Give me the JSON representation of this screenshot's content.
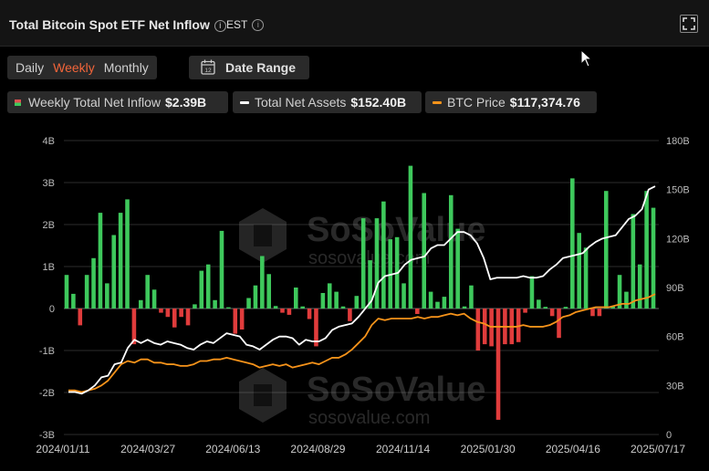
{
  "header": {
    "title": "Total Bitcoin Spot ETF Net Inflow",
    "timezone": "EST"
  },
  "tabs": [
    {
      "label": "Daily",
      "active": false
    },
    {
      "label": "Weekly",
      "active": true
    },
    {
      "label": "Monthly",
      "active": false
    }
  ],
  "date_range_label": "Date Range",
  "date_range_icon_text": "12",
  "legend": [
    {
      "label": "Weekly Total Net Inflow",
      "value": "$2.39B",
      "color": "#e05050",
      "color2": "#3ec85c"
    },
    {
      "label": "Total Net Assets",
      "value": "$152.40B",
      "color": "#ffffff"
    },
    {
      "label": "BTC Price",
      "value": "$117,374.76",
      "color": "#f7931a"
    }
  ],
  "watermark": {
    "brand": "SoSoValue",
    "url": "sosovalue.com"
  },
  "chart_data": {
    "type": "bar",
    "x_tick_labels": [
      "2024/01/11",
      "2024/03/27",
      "2024/06/13",
      "2024/08/29",
      "2024/11/14",
      "2025/01/30",
      "2025/04/16",
      "2025/07/17"
    ],
    "left_axis": {
      "ticks": [
        "4B",
        "3B",
        "2B",
        "1B",
        "0",
        "-1B",
        "-2B",
        "-3B"
      ],
      "min": -3,
      "max": 4
    },
    "right_axis": {
      "ticks": [
        "180B",
        "150B",
        "120B",
        "90B",
        "60B",
        "30B",
        "0"
      ],
      "min": 0,
      "max": 180
    },
    "colors": {
      "positive": "#3ec85c",
      "negative": "#e03c3c",
      "assets": "#ffffff",
      "price": "#f7931a"
    },
    "series": [
      {
        "name": "Weekly Total Net Inflow",
        "values": [
          0.8,
          0.35,
          -0.4,
          0.8,
          1.2,
          2.28,
          0.6,
          1.75,
          2.28,
          2.6,
          -0.85,
          0.2,
          0.8,
          0.45,
          -0.1,
          -0.2,
          -0.45,
          -0.2,
          -0.4,
          0.1,
          0.9,
          1.05,
          0.2,
          1.85,
          0.03,
          -0.6,
          -0.5,
          0.25,
          0.55,
          1.25,
          0.82,
          0.06,
          -0.1,
          -0.15,
          0.5,
          0.05,
          -0.25,
          -0.9,
          0.37,
          0.6,
          0.4,
          0.05,
          -0.3,
          0.3,
          2.15,
          1.15,
          2.15,
          2.55,
          1.65,
          1.7,
          0.6,
          3.4,
          -0.13,
          2.75,
          0.4,
          0.16,
          0.28,
          2.7,
          1.9,
          0.05,
          0.55,
          -1.0,
          -0.85,
          -0.9,
          -2.65,
          -0.85,
          -0.85,
          -0.8,
          -0.1,
          0.77,
          0.21,
          0.04,
          -0.18,
          -0.7,
          0.04,
          3.1,
          1.8,
          1.45,
          -0.18,
          -0.18,
          2.8,
          0.05,
          0.8,
          0.4,
          2.25,
          1.05,
          2.8,
          2.4
        ]
      },
      {
        "name": "Total Net Assets",
        "values": [
          26,
          26,
          25,
          27,
          30,
          35,
          36,
          43,
          44,
          53,
          58,
          56,
          58,
          56,
          55,
          57,
          56,
          55,
          53,
          52,
          55,
          57,
          56,
          59,
          62,
          61,
          60,
          55,
          54,
          52,
          55,
          58,
          60,
          60,
          59,
          55,
          58,
          57,
          57,
          59,
          64,
          66,
          67,
          68,
          72,
          77,
          82,
          93,
          97,
          98,
          99,
          104,
          107,
          108,
          109,
          114,
          116,
          116,
          120,
          124,
          124,
          122,
          117,
          108,
          95,
          96,
          96,
          96,
          96,
          97,
          96,
          96,
          97,
          101,
          104,
          108,
          109,
          110,
          111,
          115,
          118,
          120,
          121,
          122,
          127,
          132,
          134,
          138,
          150,
          152
        ]
      },
      {
        "name": "BTC Price",
        "values": [
          27,
          27,
          26,
          27,
          28,
          30,
          33,
          38,
          43,
          45,
          44,
          46,
          46,
          44,
          44,
          43,
          43,
          42,
          42,
          43,
          45,
          45,
          46,
          46,
          47,
          46,
          45,
          44,
          43,
          41,
          42,
          43,
          42,
          43,
          41,
          42,
          43,
          44,
          43,
          45,
          47,
          47,
          49,
          52,
          56,
          60,
          67,
          71,
          70,
          71,
          71,
          71,
          71,
          72,
          71,
          72,
          72,
          73,
          74,
          73,
          74,
          71,
          69,
          68,
          66,
          66,
          66,
          66,
          66,
          67,
          66,
          66,
          66,
          67,
          69,
          72,
          73,
          75,
          76,
          77,
          78,
          78,
          78,
          79,
          80,
          80,
          82,
          83,
          84,
          86
        ]
      }
    ]
  }
}
